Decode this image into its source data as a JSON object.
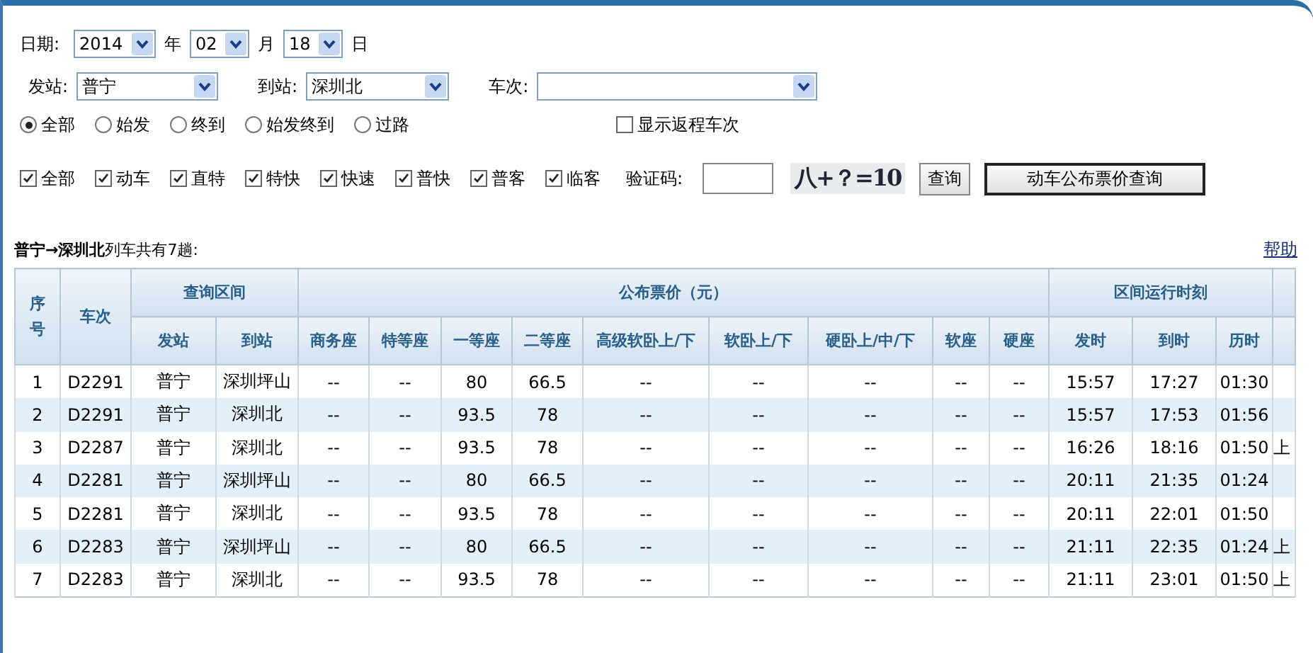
{
  "date": {
    "label": "日期:",
    "year": "2014",
    "year_unit": "年",
    "month": "02",
    "month_unit": "月",
    "day": "18",
    "day_unit": "日"
  },
  "stations": {
    "from_label": "发站:",
    "from": "普宁",
    "to_label": "到站:",
    "to": "深圳北",
    "train_label": "车次:"
  },
  "station_types": [
    {
      "label": "全部",
      "selected": true
    },
    {
      "label": "始发",
      "selected": false
    },
    {
      "label": "终到",
      "selected": false
    },
    {
      "label": "始发终到",
      "selected": false
    },
    {
      "label": "过路",
      "selected": false
    }
  ],
  "return_trains": {
    "label": "显示返程车次",
    "checked": false
  },
  "train_types": [
    {
      "label": "全部",
      "checked": true
    },
    {
      "label": "动车",
      "checked": true
    },
    {
      "label": "直特",
      "checked": true
    },
    {
      "label": "特快",
      "checked": true
    },
    {
      "label": "快速",
      "checked": true
    },
    {
      "label": "普快",
      "checked": true
    },
    {
      "label": "普客",
      "checked": true
    },
    {
      "label": "临客",
      "checked": true
    }
  ],
  "captcha": {
    "label": "验证码:",
    "image_text": "八+？=10"
  },
  "buttons": [
    "查询",
    "动车公布票价查询"
  ],
  "summary": "**普宁→深圳北**列车共有7趟:",
  "help_link": "帮助",
  "table": {
    "groups": [
      {
        "label": "序号"
      },
      {
        "label": "车次"
      },
      {
        "label": "查询区间",
        "columns": [
          "发站",
          "到站"
        ]
      },
      {
        "label": "公布票价（元）",
        "columns": [
          "商务座",
          "特等座",
          "一等座",
          "二等座",
          "高级软卧上/下",
          "软卧上/下",
          "硬卧上/中/下",
          "软座",
          "硬座"
        ]
      },
      {
        "label": "区间运行时刻",
        "columns": [
          "发时",
          "到时",
          "历时"
        ]
      }
    ],
    "rows": [
      [
        "1",
        "D2291",
        "普宁",
        "深圳坪山",
        "--",
        "--",
        "80",
        "66.5",
        "--",
        "--",
        "--",
        "--",
        "--",
        "15:57",
        "17:27",
        "01:30",
        ""
      ],
      [
        "2",
        "D2291",
        "普宁",
        "深圳北",
        "--",
        "--",
        "93.5",
        "78",
        "--",
        "--",
        "--",
        "--",
        "--",
        "15:57",
        "17:53",
        "01:56",
        ""
      ],
      [
        "3",
        "D2287",
        "普宁",
        "深圳北",
        "--",
        "--",
        "93.5",
        "78",
        "--",
        "--",
        "--",
        "--",
        "--",
        "16:26",
        "18:16",
        "01:50",
        "上"
      ],
      [
        "4",
        "D2281",
        "普宁",
        "深圳坪山",
        "--",
        "--",
        "80",
        "66.5",
        "--",
        "--",
        "--",
        "--",
        "--",
        "20:11",
        "21:35",
        "01:24",
        ""
      ],
      [
        "5",
        "D2281",
        "普宁",
        "深圳北",
        "--",
        "--",
        "93.5",
        "78",
        "--",
        "--",
        "--",
        "--",
        "--",
        "20:11",
        "22:01",
        "01:50",
        ""
      ],
      [
        "6",
        "D2283",
        "普宁",
        "深圳坪山",
        "--",
        "--",
        "80",
        "66.5",
        "--",
        "--",
        "--",
        "--",
        "--",
        "21:11",
        "22:35",
        "01:24",
        "上"
      ],
      [
        "7",
        "D2283",
        "普宁",
        "深圳北",
        "--",
        "--",
        "93.5",
        "78",
        "--",
        "--",
        "--",
        "--",
        "--",
        "21:11",
        "23:01",
        "01:50",
        "上"
      ]
    ]
  }
}
